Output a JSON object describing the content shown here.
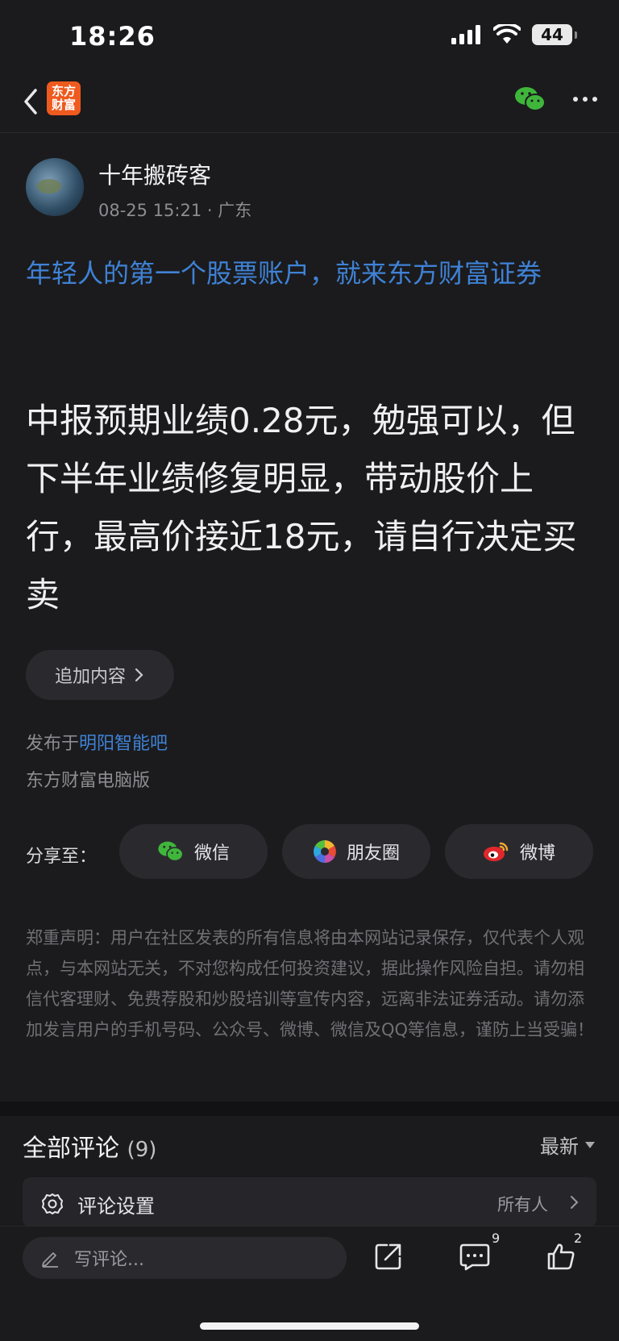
{
  "status_bar": {
    "time": "18:26",
    "battery": "44"
  },
  "nav": {
    "logo_text": "东方财富"
  },
  "post": {
    "author": "十年搬砖客",
    "date": "08-25 15:21",
    "location": "广东",
    "ad_link": "年轻人的第一个股票账户，就来东方财富证券",
    "body": "中报预期业绩0.28元，勉强可以，但下半年业绩修复明显，带动股价上行，最高价接近18元，请自行决定买卖",
    "append_label": "追加内容",
    "published_prefix": "发布于",
    "bar_name": "明阳智能吧",
    "client": "东方财富电脑版"
  },
  "share": {
    "label": "分享至：",
    "wechat": "微信",
    "moments": "朋友圈",
    "weibo": "微博"
  },
  "disclaimer": "郑重声明：用户在社区发表的所有信息将由本网站记录保存，仅代表个人观点，与本网站无关，不对您构成任何投资建议，据此操作风险自担。请勿相信代客理财、免费荐股和炒股培训等宣传内容，远离非法证券活动。请勿添加发言用户的手机号码、公众号、微博、微信及QQ等信息，谨防上当受骗！",
  "comments": {
    "title": "全部评论",
    "count": "(9)",
    "sort": "最新",
    "settings_label": "评论设置",
    "settings_value": "所有人"
  },
  "bottom_bar": {
    "write_placeholder": "写评论...",
    "comment_count": "9",
    "like_count": "2"
  }
}
